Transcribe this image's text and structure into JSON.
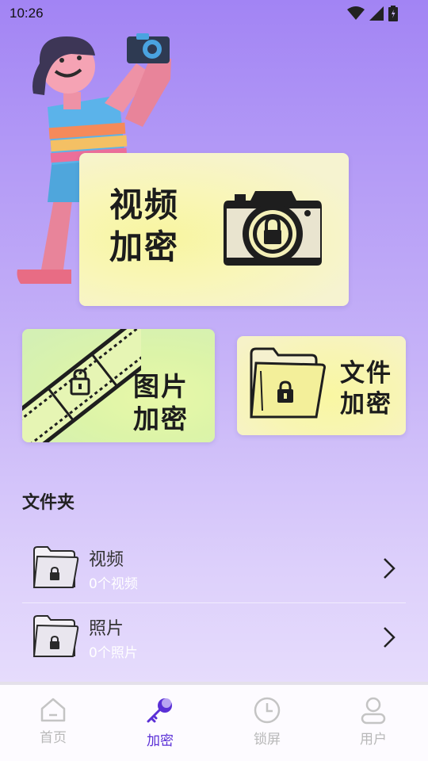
{
  "status_bar": {
    "time": "10:26"
  },
  "cards": {
    "video": {
      "line1": "视频",
      "line2": "加密"
    },
    "photo": {
      "line1": "图片",
      "line2": "加密"
    },
    "file": {
      "line1": "文件",
      "line2": "加密"
    }
  },
  "folders": {
    "title": "文件夹",
    "items": [
      {
        "name": "视频",
        "count": "0个视频"
      },
      {
        "name": "照片",
        "count": "0个照片"
      }
    ]
  },
  "tabs": [
    {
      "label": "首页",
      "icon": "home-icon",
      "active": false
    },
    {
      "label": "加密",
      "icon": "key-icon",
      "active": true
    },
    {
      "label": "锁屏",
      "icon": "clock-icon",
      "active": false
    },
    {
      "label": "用户",
      "icon": "user-icon",
      "active": false
    }
  ],
  "colors": {
    "accent": "#5a2fd6",
    "inactive": "#b8b8b8",
    "background_top": "#a284f4",
    "background_bottom": "#e6dcfc"
  }
}
